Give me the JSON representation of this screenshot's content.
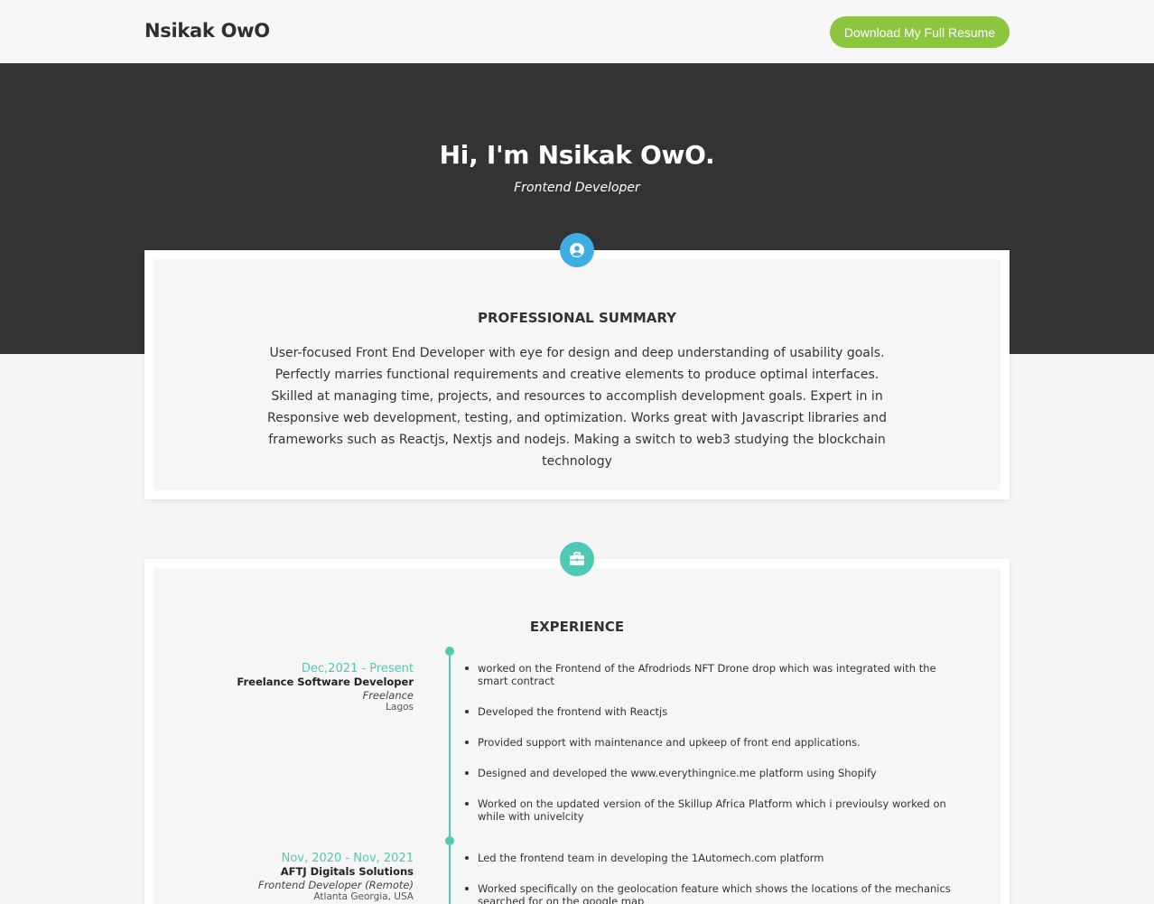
{
  "header": {
    "brand": "Nsikak OwO",
    "download_label": "Download My Full Resume"
  },
  "hero": {
    "title": "Hi, I'm Nsikak OwO.",
    "subtitle": "Frontend Developer"
  },
  "summary": {
    "icon": "user-circle-icon",
    "title": "PROFESSIONAL SUMMARY",
    "text": "User-focused Front End Developer with eye for design and deep understanding of usability goals. Perfectly marries functional requirements and creative elements to produce optimal interfaces. Skilled at managing time, projects, and resources to accomplish development goals. Expert in in Responsive web development, testing, and optimization. Works great with Javascript libraries and frameworks such as Reactjs, Nextjs and nodejs. Making a switch to web3 studying the blockchain technology"
  },
  "experience": {
    "icon": "briefcase-icon",
    "title": "EXPERIENCE",
    "jobs": [
      {
        "date": "Dec,2021 - Present",
        "title": "Freelance Software Developer",
        "type": "Freelance",
        "location": "Lagos",
        "bullets": [
          "worked on the Frontend of the Afrodriods NFT Drone drop which was integrated with the smart contract",
          "Developed the frontend with Reactjs",
          "Provided support with maintenance and upkeep of front end applications.",
          "Designed and developed the www.everythingnice.me platform using Shopify",
          "Worked on the updated version of the Skillup Africa Platform which i previoulsy worked on while with univelcity"
        ]
      },
      {
        "date": "Nov, 2020 - Nov, 2021",
        "title": "AFTJ Digitals Solutions",
        "type": "Frontend Developer (Remote)",
        "location": "Atlanta Georgia, USA",
        "bullets": [
          "Led the frontend team in developing the 1Automech.com platform",
          "Worked specifically on the geolocation feature which shows the locations of the mechanics searched for on the google map"
        ]
      }
    ]
  },
  "colors": {
    "accent_green": "#8cc63f",
    "accent_teal": "#4ec9b5",
    "accent_blue": "#3eaee2",
    "hero_bg": "#333333"
  }
}
